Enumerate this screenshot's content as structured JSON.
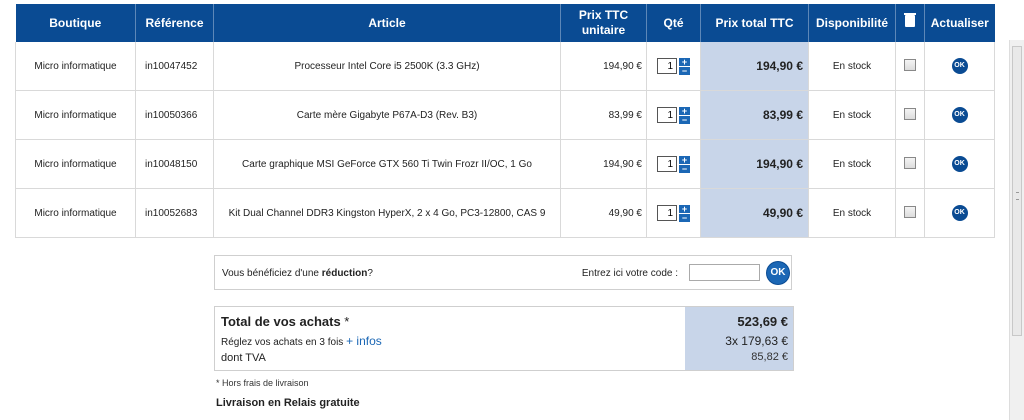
{
  "table": {
    "headers": {
      "boutique": "Boutique",
      "reference": "Référence",
      "article": "Article",
      "prix_unitaire": "Prix TTC unitaire",
      "qte": "Qté",
      "prix_total": "Prix total TTC",
      "disponibilite": "Disponibilité",
      "trash_icon": "trash-icon",
      "actualiser": "Actualiser"
    },
    "rows": [
      {
        "boutique": "Micro informatique",
        "reference": "in10047452",
        "article": "Processeur Intel Core i5 2500K (3.3 GHz)",
        "prix": "194,90 €",
        "qty": "1",
        "total": "194,90 €",
        "dispo": "En stock",
        "ok": "OK"
      },
      {
        "boutique": "Micro informatique",
        "reference": "in10050366",
        "article": "Carte mère Gigabyte P67A-D3 (Rev. B3)",
        "prix": "83,99 €",
        "qty": "1",
        "total": "83,99 €",
        "dispo": "En stock",
        "ok": "OK"
      },
      {
        "boutique": "Micro informatique",
        "reference": "in10048150",
        "article": "Carte graphique MSI GeForce GTX 560 Ti Twin Frozr II/OC, 1 Go",
        "prix": "194,90 €",
        "qty": "1",
        "total": "194,90 €",
        "dispo": "En stock",
        "ok": "OK"
      },
      {
        "boutique": "Micro informatique",
        "reference": "in10052683",
        "article": "Kit Dual Channel DDR3 Kingston HyperX, 2 x 4 Go, PC3-12800, CAS 9",
        "prix": "49,90 €",
        "qty": "1",
        "total": "49,90 €",
        "dispo": "En stock",
        "ok": "OK"
      }
    ],
    "step_plus": "+",
    "step_minus": "−"
  },
  "promo": {
    "text_pre": "Vous bénéficiez d'une ",
    "text_bold": "réduction",
    "text_post": "?",
    "code_label": "Entrez ici votre code :",
    "code_value": "",
    "ok": "OK"
  },
  "totals": {
    "title": "Total de vos achats",
    "asterisk": " *",
    "installments_text": "Réglez vos achats en 3 fois ",
    "infos_link": "+ infos",
    "tva_label": "dont TVA",
    "total": "523,69 €",
    "installments": "3x  179,63 €",
    "tva": "85,82 €"
  },
  "note": "* Hors frais de livraison",
  "livraison": "Livraison en Relais gratuite",
  "colors": {
    "header_bg": "#0a4b93",
    "total_bg": "#c8d5e9",
    "link": "#1b67b5"
  }
}
